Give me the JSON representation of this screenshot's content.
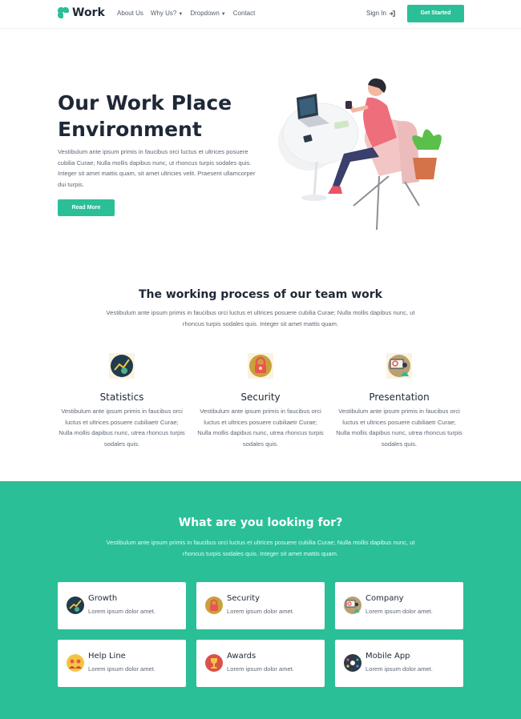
{
  "nav": {
    "logo": "Work",
    "menu": [
      {
        "label": "About Us",
        "caret": false
      },
      {
        "label": "Why Us?",
        "caret": true
      },
      {
        "label": "Dropdown",
        "caret": true
      },
      {
        "label": "Contact",
        "caret": false
      }
    ],
    "sign_in": "Sign In",
    "cta": "Get Started"
  },
  "hero": {
    "title": "Our Work Place Environment",
    "text": "Vestibulum ante ipsum primis in faucibus orci luctus et ultrices posuere cubilia Curae; Nulla mollis dapibus nunc, ut rhoncus turpis sodales quis. Integer sit amet mattis quam, sit amet ultricies velit. Praesent ullamcorper dui turpis.",
    "button": "Read More"
  },
  "process": {
    "title": "The working process of our team work",
    "text": "Vestibulum ante ipsum primis in faucibus orci luctus et ultrices posuere cubilia Curae; Nulla mollis dapibus nunc, ut rhoncus turpis sodales quis. Integer sit amet mattis quam.",
    "features": [
      {
        "title": "Statistics",
        "text": "Vestibulum ante ipsum primis in faucibus orci luctus et ultrices posuere cubiliaetr Curae; Nulla mollis dapibus nunc, utrea rhoncus turpis sodales quis.",
        "icon": "statistics-icon"
      },
      {
        "title": "Security",
        "text": "Vestibulum ante ipsum primis in faucibus orci luctus et ultrices posuere cubiliaetr Curae; Nulla mollis dapibus nunc, utrea rhoncus turpis sodales quis.",
        "icon": "security-icon"
      },
      {
        "title": "Presentation",
        "text": "Vestibulum ante ipsum primis in faucibus orci luctus et ultrices posuere cubiliaetr Curae; Nulla mollis dapibus nunc, utrea rhoncus turpis sodales quis.",
        "icon": "presentation-icon"
      }
    ]
  },
  "looking": {
    "title": "What are you looking for?",
    "text": "Vestibulum ante ipsum primis in faucibus orci luctus et ultrices posuere cubilia Curae; Nulla mollis dapibus nunc, ut rhoncus turpis sodales quis. Integer sit amet mattis quam.",
    "cards": [
      {
        "title": "Growth",
        "text": "Lorem ipsum dolor amet.",
        "icon": "growth-icon"
      },
      {
        "title": "Security",
        "text": "Lorem ipsum dolor amet.",
        "icon": "security-icon"
      },
      {
        "title": "Company",
        "text": "Lorem ipsum dolor amet.",
        "icon": "company-icon"
      },
      {
        "title": "Help Line",
        "text": "Lorem ipsum dolor amet.",
        "icon": "help-line-icon"
      },
      {
        "title": "Awards",
        "text": "Lorem ipsum dolor amet.",
        "icon": "awards-icon"
      },
      {
        "title": "Mobile App",
        "text": "Lorem ipsum dolor amet.",
        "icon": "mobile-app-icon"
      }
    ]
  },
  "colors": {
    "accent": "#2bbf97",
    "heading": "#1f2836",
    "body_text": "#5f6875"
  }
}
